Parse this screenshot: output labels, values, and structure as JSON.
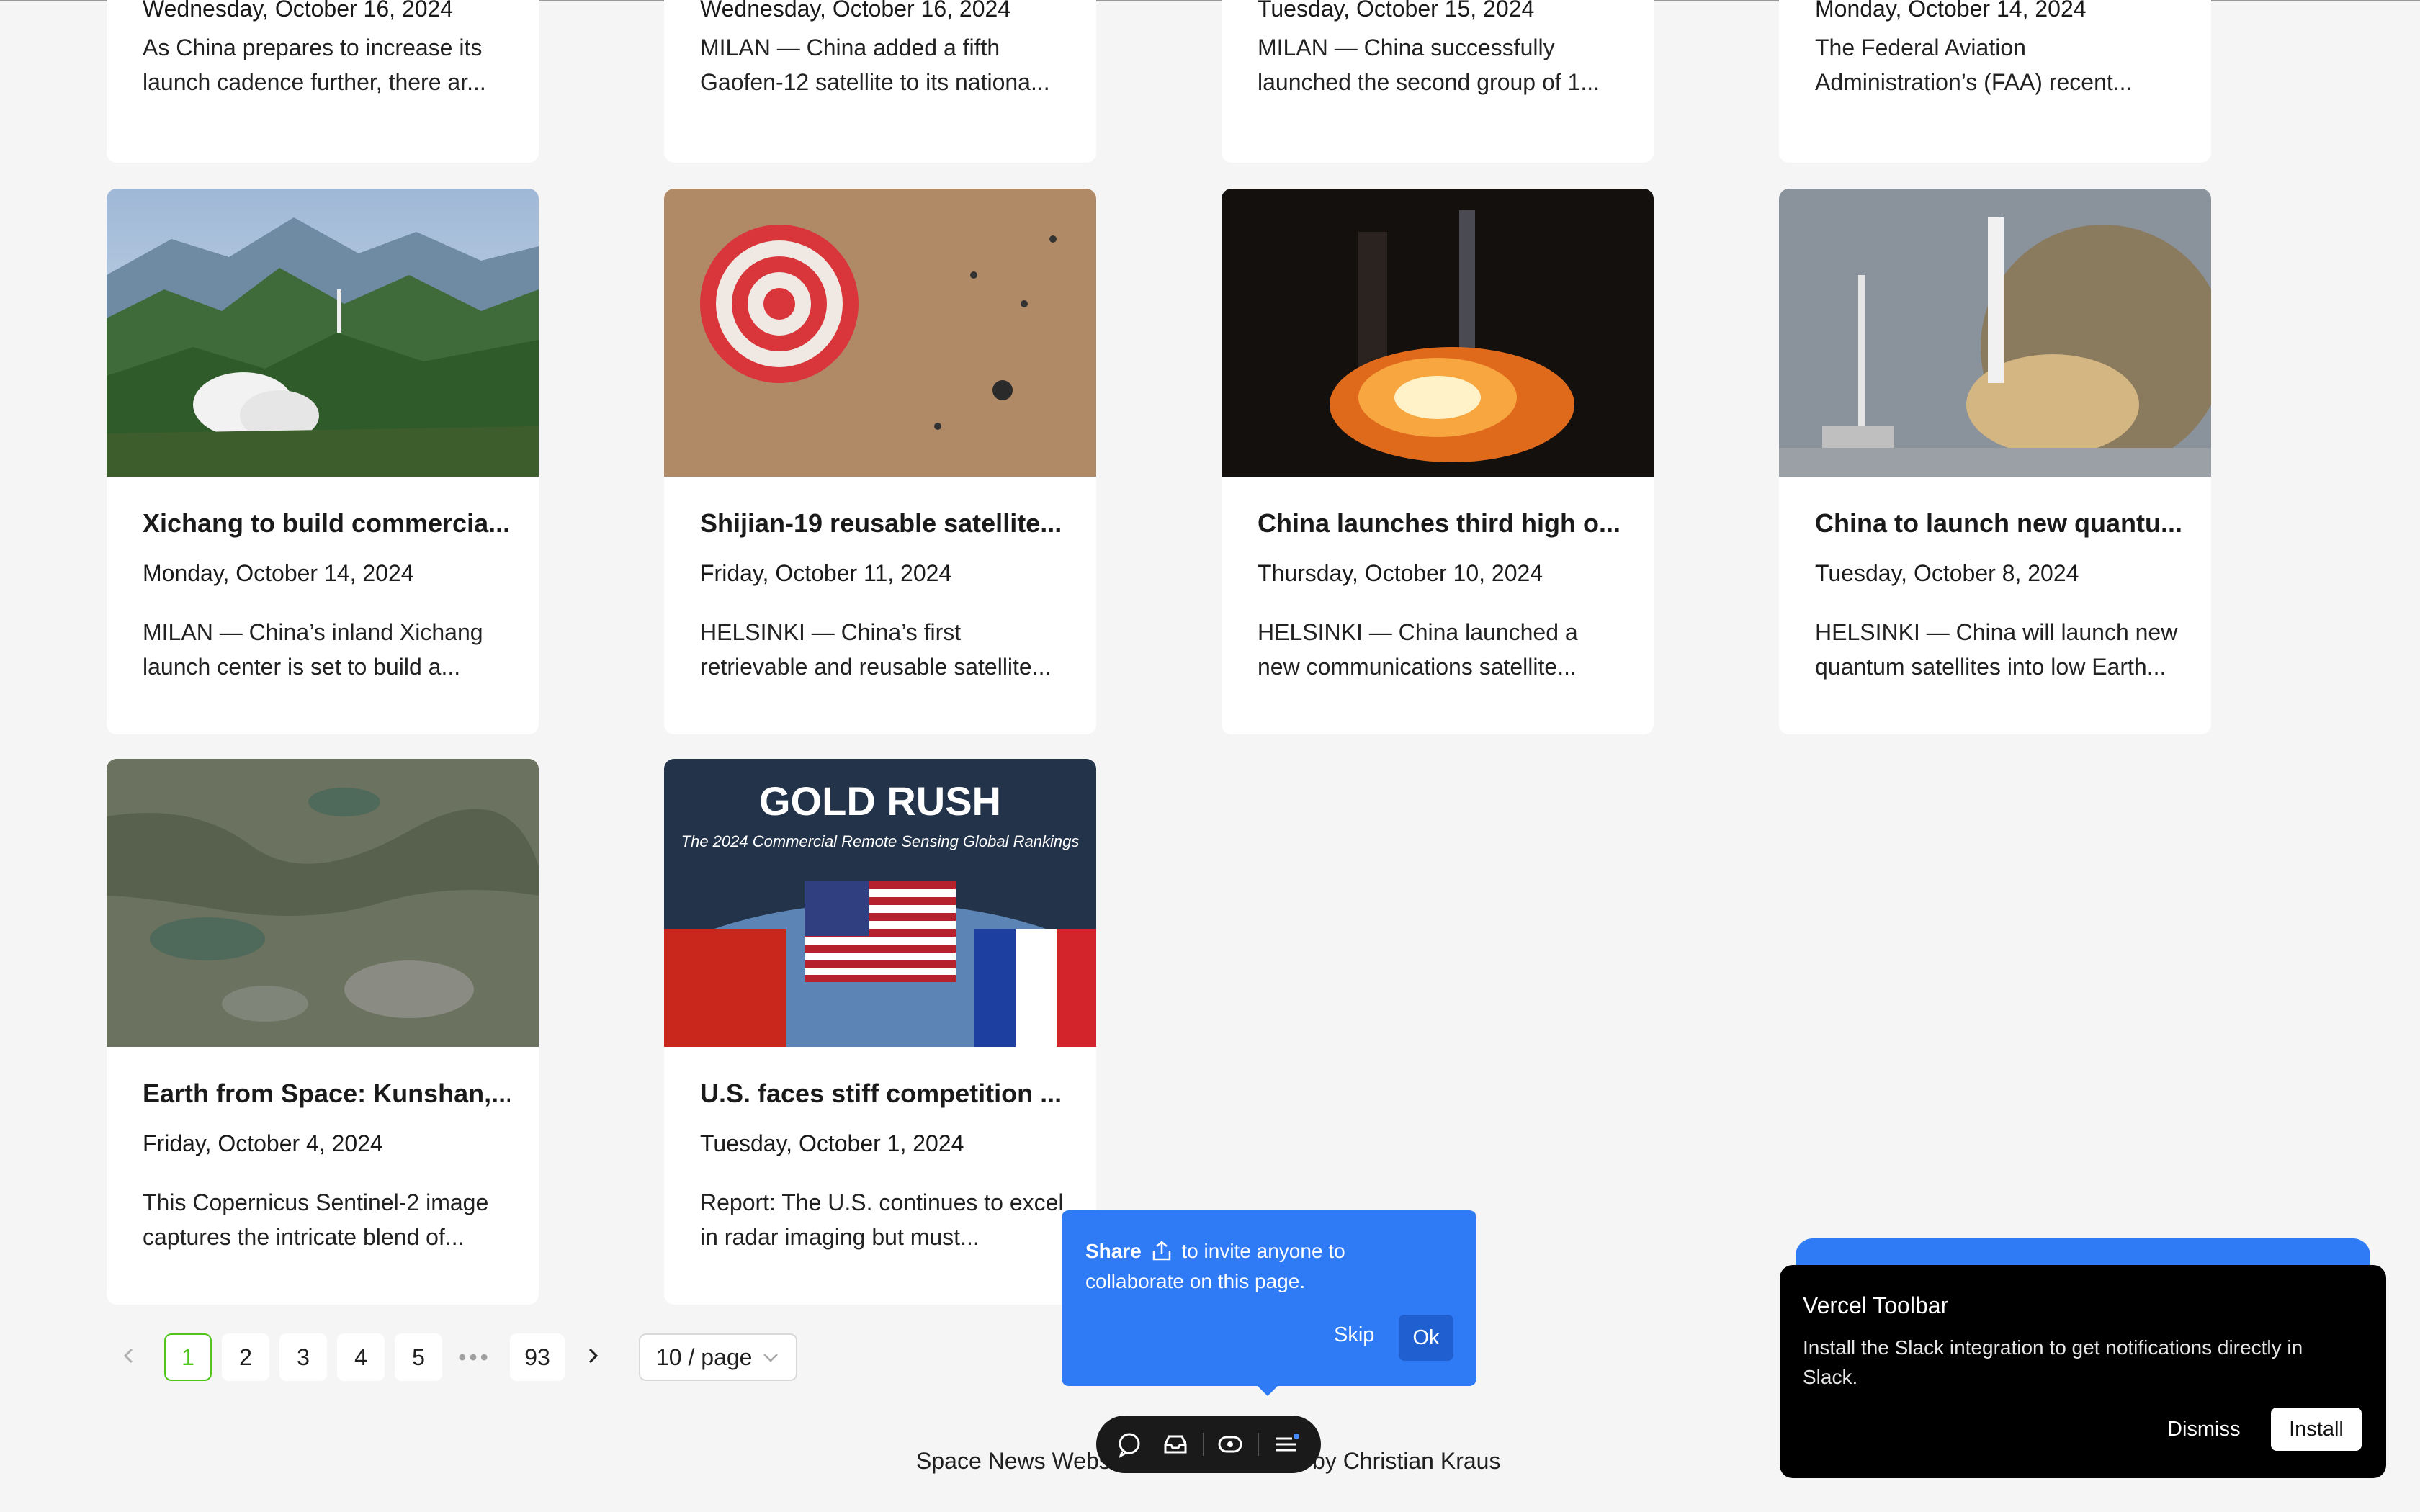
{
  "cards_top_row": [
    {
      "date": "Wednesday, October 16, 2024",
      "excerpt": "As China prepares to increase its launch cadence further, there ar..."
    },
    {
      "date": "Wednesday, October 16, 2024",
      "excerpt": "MILAN — China added a fifth Gaofen-12 satellite to its nationa..."
    },
    {
      "date": "Tuesday, October 15, 2024",
      "excerpt": "MILAN — China successfully launched the second group of 1..."
    },
    {
      "date": "Monday, October 14, 2024",
      "excerpt": "The Federal Aviation Administration’s (FAA) recent..."
    }
  ],
  "cards": [
    {
      "title": "Xichang to build commercia...",
      "date": "Monday, October 14, 2024",
      "excerpt": "MILAN — China’s inland Xichang launch center is set to build a...",
      "image": "mountain-launch-image"
    },
    {
      "title": "Shijian-19 reusable satellite...",
      "date": "Friday, October 11, 2024",
      "excerpt": "HELSINKI — China’s first retrievable and reusable satellite...",
      "image": "parachute-landing-image"
    },
    {
      "title": "China launches third high o...",
      "date": "Thursday, October 10, 2024",
      "excerpt": "HELSINKI — China launched a new communications satellite...",
      "image": "night-launch-image"
    },
    {
      "title": "China to launch new quantu...",
      "date": "Tuesday, October 8, 2024",
      "excerpt": "HELSINKI — China will launch new quantum satellites into low Earth...",
      "image": "rocket-liftoff-image"
    },
    {
      "title": "Earth from Space: Kunshan,...",
      "date": "Friday, October 4, 2024",
      "excerpt": "This Copernicus Sentinel-2 image captures the intricate blend of...",
      "image": "satellite-terrain-image"
    },
    {
      "title": "U.S. faces stiff competition ...",
      "date": "Tuesday, October 1, 2024",
      "excerpt": "Report: The U.S. continues to excel in radar imaging but must...",
      "image": "gold-rush-flags-image",
      "image_text": {
        "headline": "GOLD RUSH",
        "subline": "The 2024 Commercial Remote Sensing Global Rankings"
      }
    }
  ],
  "pagination": {
    "prev_icon": "chevron-left-icon",
    "pages": [
      "1",
      "2",
      "3",
      "4",
      "5"
    ],
    "ellipsis": "•••",
    "last_page": "93",
    "current": "1",
    "next_icon": "chevron-right-icon",
    "page_size": "10 / page"
  },
  "footer": {
    "left": "Space News Webs",
    "right": "by Christian Kraus"
  },
  "share_popup": {
    "bold": "Share",
    "text": "to invite anyone to collaborate on this page.",
    "skip": "Skip",
    "ok": "Ok"
  },
  "toolbar_pill": {
    "icons": [
      "comment-icon",
      "inbox-icon",
      "eye-icon",
      "menu-icon"
    ]
  },
  "vercel_toast": {
    "title": "Vercel Toolbar",
    "description": "Install the Slack integration to get notifications directly in Slack.",
    "dismiss": "Dismiss",
    "install": "Install"
  },
  "colors": {
    "accent_green": "#52c41a",
    "share_blue": "#2f7af5",
    "page_bg": "#f5f5f5"
  }
}
